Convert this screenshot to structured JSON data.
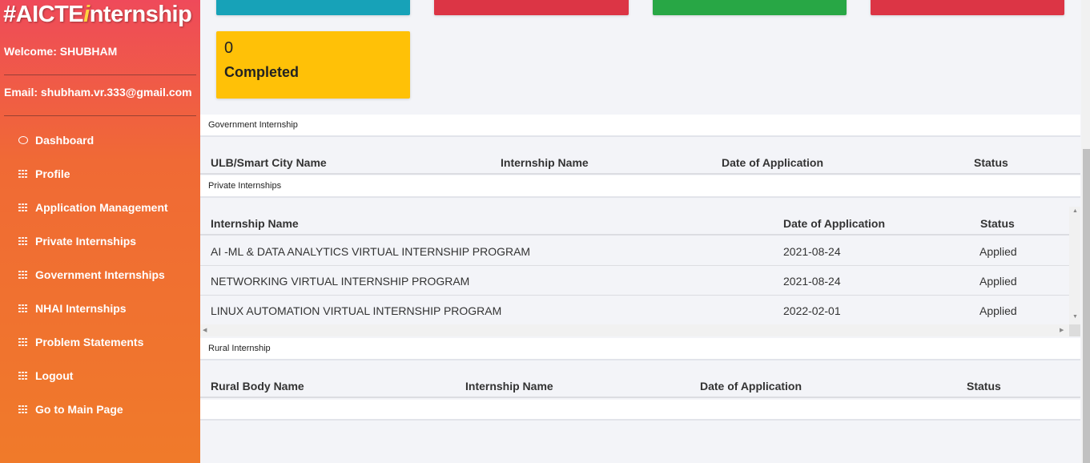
{
  "brand": {
    "prefix": "#AICTE",
    "accent": "i",
    "suffix": "nternship"
  },
  "user": {
    "welcome": "Welcome: SHUBHAM",
    "email": "Email: shubham.vr.333@gmail.com"
  },
  "nav": [
    {
      "label": "Dashboard",
      "icon": "circle-icon"
    },
    {
      "label": "Profile",
      "icon": "grid-icon"
    },
    {
      "label": "Application Management",
      "icon": "grid-icon"
    },
    {
      "label": "Private Internships",
      "icon": "grid-icon"
    },
    {
      "label": "Government Internships",
      "icon": "grid-icon"
    },
    {
      "label": "NHAI Internships",
      "icon": "grid-icon"
    },
    {
      "label": "Problem Statements",
      "icon": "grid-icon"
    },
    {
      "label": "Logout",
      "icon": "grid-icon"
    },
    {
      "label": "Go to Main Page",
      "icon": "grid-icon"
    }
  ],
  "completed_card": {
    "count": "0",
    "label": "Completed"
  },
  "government": {
    "title": "Government Internship",
    "headers": [
      "ULB/Smart City Name",
      "Internship Name",
      "Date of Application",
      "Status"
    ]
  },
  "private": {
    "title": "Private Internships",
    "headers": [
      "Internship Name",
      "Date of Application",
      "Status"
    ],
    "rows": [
      {
        "name": "AI -ML & DATA ANALYTICS VIRTUAL INTERNSHIP PROGRAM",
        "date": "2021-08-24",
        "status": "Applied"
      },
      {
        "name": "NETWORKING VIRTUAL INTERNSHIP PROGRAM",
        "date": "2021-08-24",
        "status": "Applied"
      },
      {
        "name": "LINUX AUTOMATION VIRTUAL INTERNSHIP PROGRAM",
        "date": "2022-02-01",
        "status": "Applied"
      }
    ]
  },
  "rural": {
    "title": "Rural Internship",
    "headers": [
      "Rural Body Name",
      "Internship Name",
      "Date of Application",
      "Status"
    ]
  },
  "colors": {
    "teal": "#17a2b8",
    "red": "#dc3545",
    "green": "#28a745",
    "yellow": "#ffc107"
  }
}
